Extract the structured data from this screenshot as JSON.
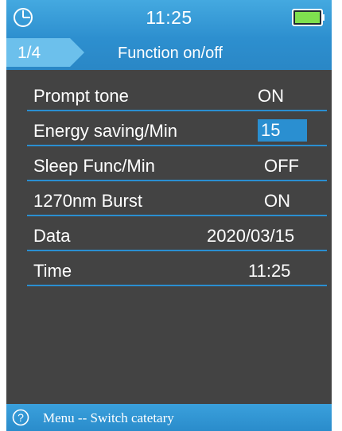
{
  "status": {
    "time": "11:25",
    "clock_icon": "clock-icon",
    "battery_icon": "battery-icon",
    "battery_level": 1.0,
    "battery_color": "#7fe04f"
  },
  "header": {
    "page_indicator": "1/4",
    "title": "Function on/off"
  },
  "settings": [
    {
      "label": "Prompt tone",
      "value": "ON",
      "selected": false
    },
    {
      "label": "Energy saving/Min",
      "value": "15",
      "selected": true
    },
    {
      "label": "Sleep Func/Min",
      "value": "OFF",
      "selected": false
    },
    {
      "label": "1270nm Burst",
      "value": "ON",
      "selected": false
    },
    {
      "label": "Data",
      "value": "2020/03/15",
      "selected": false
    },
    {
      "label": "Time",
      "value": "11:25",
      "selected": false
    }
  ],
  "footer": {
    "help_icon": "help-icon",
    "hint": "Menu -- Switch catetary"
  },
  "colors": {
    "accent": "#2a8fd1",
    "background": "#434343",
    "text": "#ffffff"
  }
}
